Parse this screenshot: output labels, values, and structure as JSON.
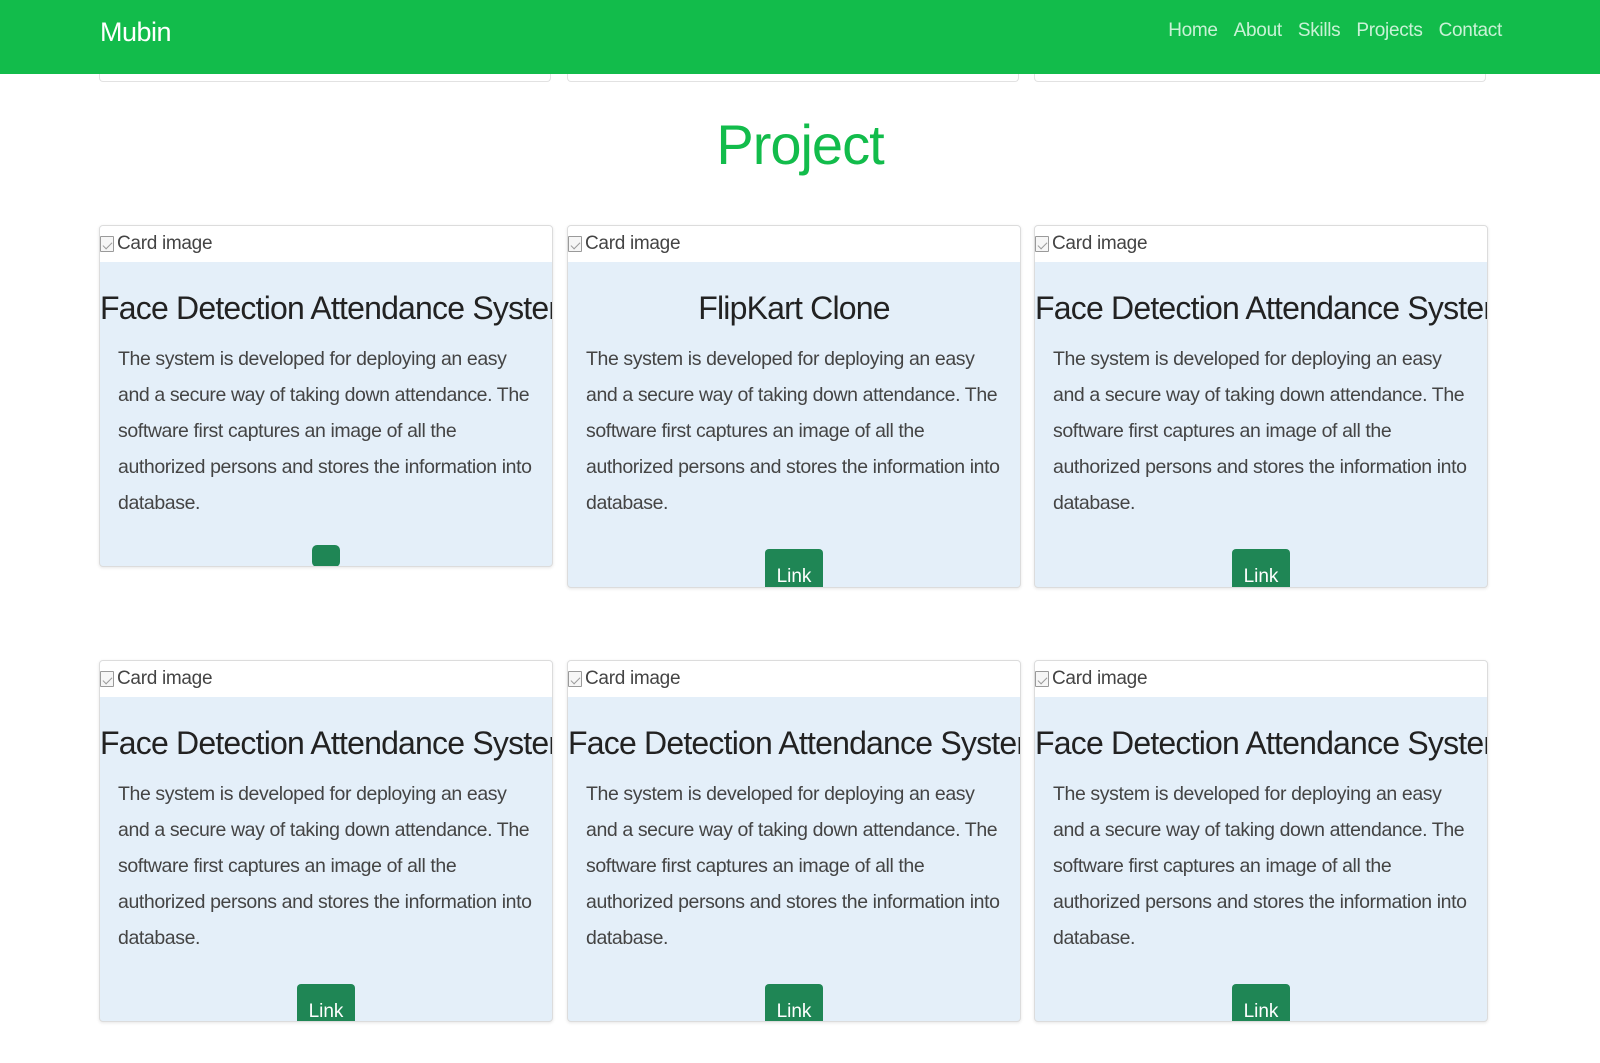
{
  "nav": {
    "brand": "Mubin",
    "links": [
      "Home",
      "About",
      "Skills",
      "Projects",
      "Contact"
    ]
  },
  "section": {
    "title": "Project"
  },
  "colors": {
    "navbar": "#12bc4b",
    "title": "#12bc4b",
    "card_bg": "#e4eff9",
    "button": "#1f8655"
  },
  "cards": [
    {
      "image_alt": "Card image",
      "title": "Face Detection Attendance System",
      "text": "The system is developed for deploying an easy and a secure way of taking down attendance. The software first captures an image of all the authorized persons and stores the information into database.",
      "button": ""
    },
    {
      "image_alt": "Card image",
      "title": "FlipKart Clone",
      "text": "The system is developed for deploying an easy and a secure way of taking down attendance. The software first captures an image of all the authorized persons and stores the information into database.",
      "button": "Link"
    },
    {
      "image_alt": "Card image",
      "title": "Face Detection Attendance System",
      "text": "The system is developed for deploying an easy and a secure way of taking down attendance. The software first captures an image of all the authorized persons and stores the information into database.",
      "button": "Link"
    },
    {
      "image_alt": "Card image",
      "title": "Face Detection Attendance System",
      "text": "The system is developed for deploying an easy and a secure way of taking down attendance. The software first captures an image of all the authorized persons and stores the information into database.",
      "button": "Link"
    },
    {
      "image_alt": "Card image",
      "title": "Face Detection Attendance System",
      "text": "The system is developed for deploying an easy and a secure way of taking down attendance. The software first captures an image of all the authorized persons and stores the information into database.",
      "button": "Link"
    },
    {
      "image_alt": "Card image",
      "title": "Face Detection Attendance System",
      "text": "The system is developed for deploying an easy and a secure way of taking down attendance. The software first captures an image of all the authorized persons and stores the information into database.",
      "button": "Link"
    }
  ]
}
